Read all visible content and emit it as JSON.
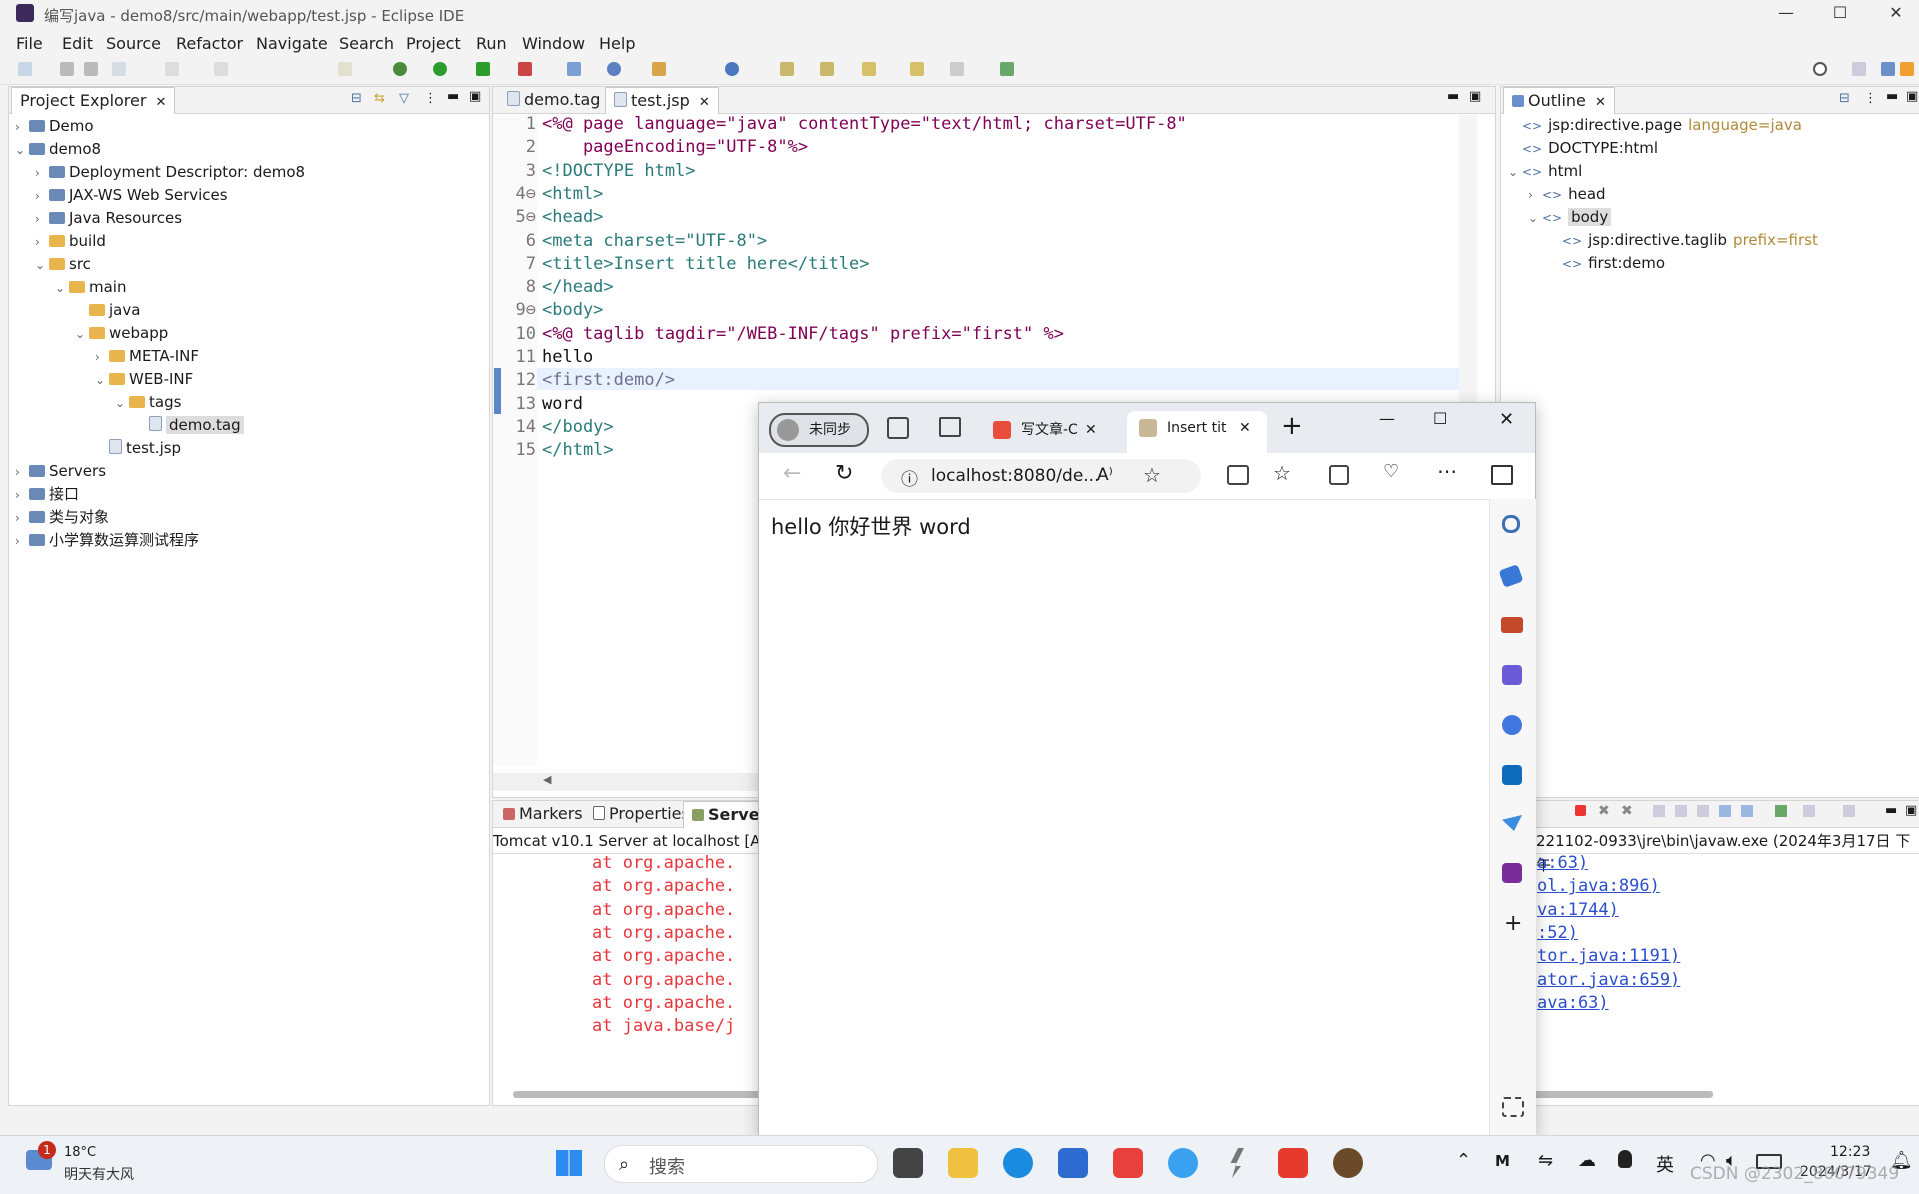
{
  "window": {
    "title": "编写java - demo8/src/main/webapp/test.jsp - Eclipse IDE"
  },
  "menus": [
    "File",
    "Edit",
    "Source",
    "Refactor",
    "Navigate",
    "Search",
    "Project",
    "Run",
    "Window",
    "Help"
  ],
  "project_explorer": {
    "tab": "Project Explorer",
    "items": [
      {
        "label": "Demo",
        "level": 0,
        "expanded": false,
        "kind": "project"
      },
      {
        "label": "demo8",
        "level": 0,
        "expanded": true,
        "kind": "project"
      },
      {
        "label": "Deployment Descriptor: demo8",
        "level": 1,
        "expanded": false,
        "kind": "descriptor"
      },
      {
        "label": "JAX-WS Web Services",
        "level": 1,
        "expanded": false,
        "kind": "service"
      },
      {
        "label": "Java Resources",
        "level": 1,
        "expanded": false,
        "kind": "resources"
      },
      {
        "label": "build",
        "level": 1,
        "expanded": false,
        "kind": "folder"
      },
      {
        "label": "src",
        "level": 1,
        "expanded": true,
        "kind": "folder"
      },
      {
        "label": "main",
        "level": 2,
        "expanded": true,
        "kind": "folder"
      },
      {
        "label": "java",
        "level": 3,
        "expanded": null,
        "kind": "folder"
      },
      {
        "label": "webapp",
        "level": 3,
        "expanded": true,
        "kind": "folder"
      },
      {
        "label": "META-INF",
        "level": 4,
        "expanded": false,
        "kind": "folder"
      },
      {
        "label": "WEB-INF",
        "level": 4,
        "expanded": true,
        "kind": "folder"
      },
      {
        "label": "tags",
        "level": 5,
        "expanded": true,
        "kind": "folder"
      },
      {
        "label": "demo.tag",
        "level": 6,
        "expanded": null,
        "kind": "file",
        "selected": true
      },
      {
        "label": "test.jsp",
        "level": 4,
        "expanded": null,
        "kind": "file"
      },
      {
        "label": "Servers",
        "level": 0,
        "expanded": false,
        "kind": "project"
      },
      {
        "label": "接口",
        "level": 0,
        "expanded": false,
        "kind": "project"
      },
      {
        "label": "类与对象",
        "level": 0,
        "expanded": false,
        "kind": "project"
      },
      {
        "label": "小学算数运算测试程序",
        "level": 0,
        "expanded": false,
        "kind": "project"
      }
    ]
  },
  "editor": {
    "tabs": [
      {
        "label": "demo.tag",
        "active": false
      },
      {
        "label": "test.jsp",
        "active": true
      }
    ],
    "line_numbers": [
      "1",
      "2",
      "3",
      "4⊖",
      "5⊖",
      "6",
      "7",
      "8",
      "9⊖",
      "10",
      "11",
      "12",
      "13",
      "14",
      "15"
    ],
    "lines": [
      "<%@ page language=\"java\" contentType=\"text/html; charset=UTF-8\"",
      "    pageEncoding=\"UTF-8\"%>",
      "<!DOCTYPE html>",
      "<html>",
      "<head>",
      "<meta charset=\"UTF-8\">",
      "<title>Insert title here</title>",
      "</head>",
      "<body>",
      "<%@ taglib tagdir=\"/WEB-INF/tags\" prefix=\"first\" %>",
      "hello",
      "<first:demo/>",
      "word",
      "</body>",
      "</html>"
    ]
  },
  "outline": {
    "tab": "Outline",
    "items": [
      {
        "label": "jsp:directive.page",
        "extra": "language=java",
        "level": 0
      },
      {
        "label": "DOCTYPE:html",
        "extra": "",
        "level": 0
      },
      {
        "label": "html",
        "extra": "",
        "level": 0
      },
      {
        "label": "head",
        "extra": "",
        "level": 1
      },
      {
        "label": "body",
        "extra": "",
        "level": 1,
        "selected": true
      },
      {
        "label": "jsp:directive.taglib",
        "extra": "prefix=first",
        "level": 2
      },
      {
        "label": "first:demo",
        "extra": "",
        "level": 2
      }
    ]
  },
  "bottom_panel": {
    "tabs": [
      "Markers",
      "Properties",
      "Server"
    ],
    "server_line": "Tomcat v10.1 Server at localhost [Ap",
    "console_right_header": "221102-0933\\jre\\bin\\javaw.exe  (2024年3月17日 下午",
    "error_lines": [
      "at org.apache.",
      "at org.apache.",
      "at org.apache.",
      "at org.apache.",
      "at org.apache.",
      "at org.apache.",
      "at org.apache.",
      "at java.base/j"
    ],
    "link_lines": [
      "a:63)",
      "ol.java:896)",
      "va:1744)",
      ":52)",
      "tor.java:1191)",
      "ator.java:659)",
      "ava:63)"
    ]
  },
  "browser": {
    "profile": "未同步",
    "tabs": [
      {
        "label": "写文章-C",
        "active": false
      },
      {
        "label": "Insert titl",
        "active": true
      }
    ],
    "address": "localhost:8080/de...",
    "page_text": "hello 你好世界 word"
  },
  "taskbar": {
    "weather_temp": "18°C",
    "weather_desc": "明天有大风",
    "notif_count": "1",
    "search_placeholder": "搜索",
    "ime": "英",
    "time": "12:23",
    "date": "2024/3/17",
    "watermark": "CSDN @2302_80079349"
  }
}
